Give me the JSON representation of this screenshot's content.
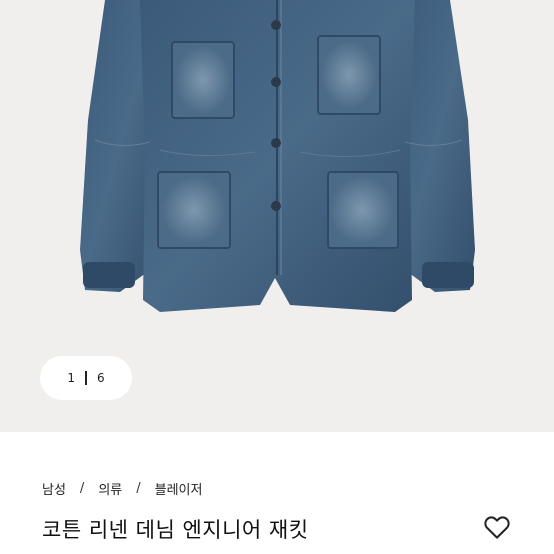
{
  "gallery": {
    "current_page": "1",
    "total_pages": "6"
  },
  "breadcrumb": [
    {
      "label": "남성"
    },
    {
      "label": "의류"
    },
    {
      "label": "블레이저"
    }
  ],
  "breadcrumb_separator": "/",
  "product": {
    "title": "코튼 리넨 데님 엔지니어 재킷"
  },
  "colors": {
    "background": "#f1efee",
    "denim": "#3a5878",
    "denim_light": "#6b86a0"
  },
  "icons": {
    "wishlist": "heart-outline-icon"
  }
}
